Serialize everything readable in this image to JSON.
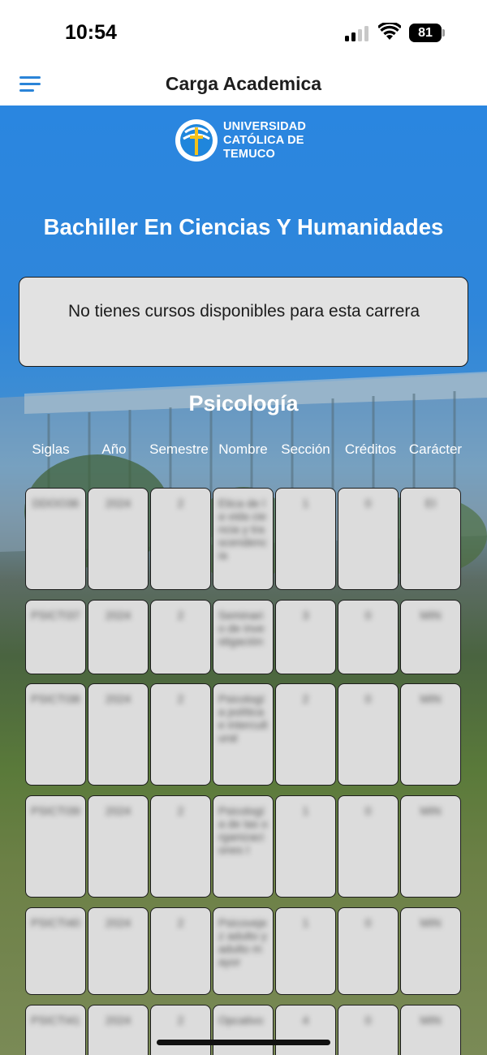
{
  "status_bar": {
    "time": "10:54",
    "battery": "81",
    "icons": [
      "signal-icon",
      "wifi-icon",
      "battery-icon"
    ]
  },
  "nav": {
    "title": "Carga Academica",
    "menu_icon": "hamburger-menu-icon"
  },
  "logo": {
    "line1": "UNIVERSIDAD",
    "line2": "CATÓLICA DE",
    "line3": "TEMUCO"
  },
  "career_title": "Bachiller En Ciencias Y Humanidades",
  "notice": "No tienes cursos disponibles para esta carrera",
  "section_title": "Psicología",
  "columns": [
    "Siglas",
    "Año",
    "Semestre",
    "Nombre",
    "Sección",
    "Créditos",
    "Carácter"
  ],
  "rows": [
    {
      "sigla": "DDOO36",
      "anio": "2024",
      "semestre": "2",
      "nombre": "Etica de la vida ciencia y trascendencia",
      "seccion": "1",
      "creditos": "0",
      "caracter": "EI"
    },
    {
      "sigla": "PSICTI37",
      "anio": "2024",
      "semestre": "2",
      "nombre": "Seminario de investigación",
      "seccion": "3",
      "creditos": "0",
      "caracter": "MIN"
    },
    {
      "sigla": "PSICTI38",
      "anio": "2024",
      "semestre": "2",
      "nombre": "Psicología política e intercultural",
      "seccion": "2",
      "creditos": "0",
      "caracter": "MIN"
    },
    {
      "sigla": "PSICTI39",
      "anio": "2024",
      "semestre": "2",
      "nombre": "Psicología de las organizaciones I",
      "seccion": "1",
      "creditos": "0",
      "caracter": "MIN"
    },
    {
      "sigla": "PSICTI40",
      "anio": "2024",
      "semestre": "2",
      "nombre": "Psicovejez adulto y adulto mayor",
      "seccion": "1",
      "creditos": "0",
      "caracter": "MIN"
    },
    {
      "sigla": "PSICTI41",
      "anio": "2024",
      "semestre": "2",
      "nombre": "Opcativo",
      "seccion": "4",
      "creditos": "0",
      "caracter": "MIN"
    }
  ],
  "colors": {
    "accent": "#2a84d8",
    "cell_bg": "#dcdcdc",
    "header_bg": "#ffffff"
  }
}
